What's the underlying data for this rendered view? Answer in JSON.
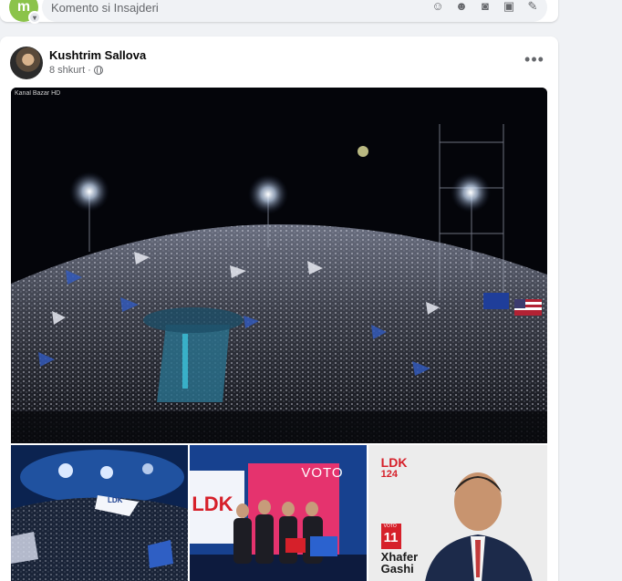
{
  "comment_box": {
    "avatar_text": "m",
    "placeholder": "Komento si Insajderi",
    "icons": [
      "sticker-icon",
      "emoji-icon",
      "camera-icon",
      "gif-icon",
      "avatar-sticker-icon"
    ]
  },
  "post": {
    "author": "Kushtrim Sallova",
    "time": "8 shkurt",
    "separator": "·",
    "more_label": "•••",
    "privacy_icon": "globe-icon",
    "images": {
      "watermark": "Kanal Bazar HD",
      "tile3": {
        "party": "LDK",
        "list_number": "124",
        "voto_label": "VOTO",
        "candidate_number": "11",
        "first_name": "Xhafer",
        "last_name": "Gashi"
      },
      "tile2": {
        "banner": "VOTO",
        "logo": "LDK"
      },
      "tile1": {
        "flag_text": "LDK"
      }
    }
  },
  "colors": {
    "ldk_red": "#d6202a",
    "ldk_blue": "#1b3f8f",
    "facebook_grey": "#65676b"
  }
}
